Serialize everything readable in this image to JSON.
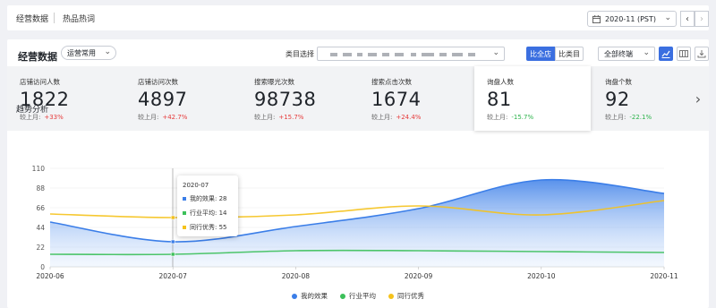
{
  "topbar": {
    "tabs": [
      "经营数据",
      "热品热词"
    ],
    "date_value": "2020-11 (PST)"
  },
  "panel": {
    "title": "经营数据",
    "preset_select": "运营常用",
    "category_label": "类目选择",
    "compare_buttons": [
      "比全店",
      "比类目"
    ],
    "terminal_select": "全部终端"
  },
  "icons": {
    "calendar": "calendar-icon",
    "line_chart": "line-chart-icon",
    "table_view": "table-icon",
    "download": "download-icon"
  },
  "cards": [
    {
      "title": "店铺访问人数",
      "value": "1822",
      "compare_label": "较上月:",
      "change": "+33%",
      "direction": "up"
    },
    {
      "title": "店铺访问次数",
      "value": "4897",
      "compare_label": "较上月:",
      "change": "+42.7%",
      "direction": "up"
    },
    {
      "title": "搜索曝光次数",
      "value": "98738",
      "compare_label": "较上月:",
      "change": "+15.7%",
      "direction": "up"
    },
    {
      "title": "搜索点击次数",
      "value": "1674",
      "compare_label": "较上月:",
      "change": "+24.4%",
      "direction": "up"
    },
    {
      "title": "询盘人数",
      "value": "81",
      "compare_label": "较上月:",
      "change": "-15.7%",
      "direction": "down"
    },
    {
      "title": "询盘个数",
      "value": "92",
      "compare_label": "较上月:",
      "change": "-22.1%",
      "direction": "down"
    }
  ],
  "trend_title": "趋势分析",
  "chart_data": {
    "type": "area",
    "categories": [
      "2020-06",
      "2020-07",
      "2020-08",
      "2020-09",
      "2020-10",
      "2020-11"
    ],
    "ylim": [
      0,
      110
    ],
    "yticks": [
      0,
      22,
      44,
      66,
      88,
      110
    ],
    "series": [
      {
        "name": "我的效果",
        "color": "#3b7ee8",
        "values": [
          50,
          28,
          45,
          65,
          97,
          82
        ]
      },
      {
        "name": "行业平均",
        "color": "#3cc05a",
        "values": [
          14,
          14,
          18,
          18,
          17,
          16
        ]
      },
      {
        "name": "同行优秀",
        "color": "#f5c21b",
        "values": [
          59,
          55,
          58,
          68,
          58,
          74
        ]
      }
    ],
    "tooltip": {
      "category": "2020-07",
      "rows": [
        "我的效果: 28",
        "行业平均: 14",
        "同行优秀: 55"
      ]
    },
    "grid": true,
    "legend_position": "bottom"
  }
}
